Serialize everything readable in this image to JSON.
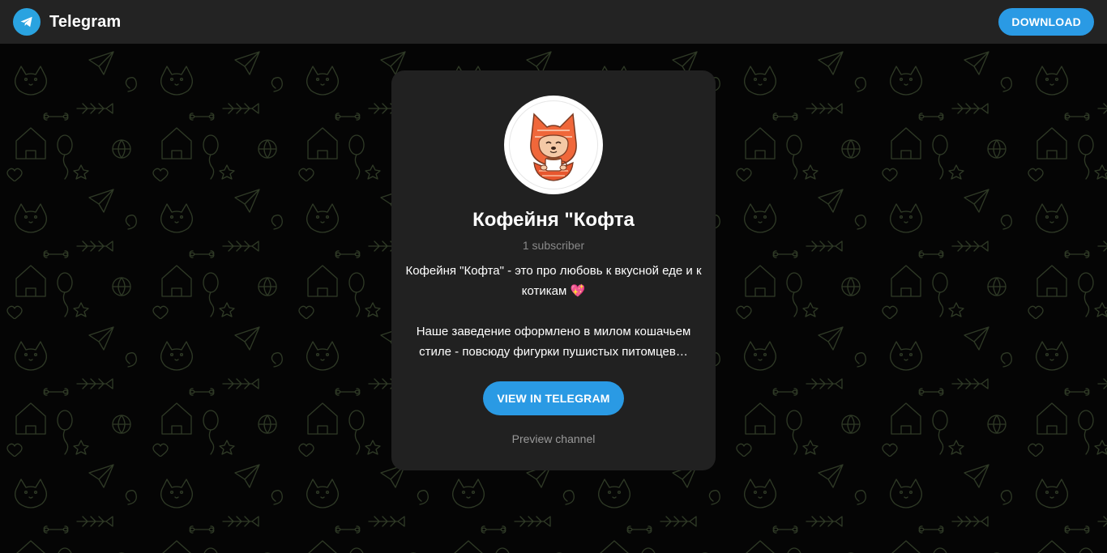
{
  "header": {
    "app_name": "Telegram",
    "logo_icon": "telegram-paper-plane-icon",
    "download_label": "DOWNLOAD"
  },
  "channel": {
    "title": "Кофейня \"Кофта",
    "subscribers": "1 subscriber",
    "avatar_icon": "cat-with-coffee-cup-icon",
    "description_line1": "Кофейня \"Кофта\" - это про любовь к вкусной еде и к котикам 💖",
    "description_line2": "Наше заведение оформлено в милом кошачьем стиле - повсюду фигурки пушистых питомцев…",
    "view_button_label": "VIEW IN TELEGRAM",
    "preview_link_label": "Preview channel"
  },
  "colors": {
    "accent": "#2a9ae4",
    "header_bg": "#232323",
    "card_bg": "#212121",
    "page_bg": "#050505",
    "pattern_stroke": "#2f3a26"
  }
}
